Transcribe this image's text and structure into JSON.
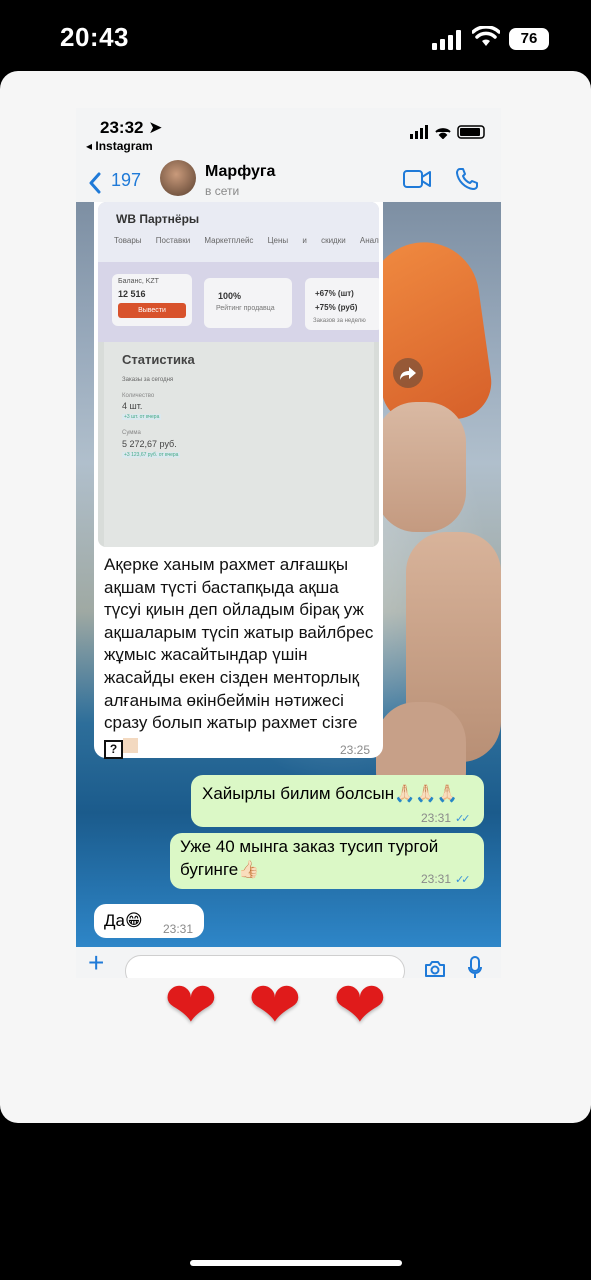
{
  "status_bar": {
    "time": "20:43",
    "battery": "76"
  },
  "inner_status": {
    "time": "23:32 ➤",
    "back_app": "◂ Instagram"
  },
  "chat_header": {
    "back_count": "197",
    "contact_name": "Марфуга",
    "contact_status": "в сети"
  },
  "screenshot": {
    "title": "WB Партнёры",
    "menu": "Товары Поставки Маркетплейс Цены и скидки Аналитика Ка",
    "balance_label": "Баланс, KZT",
    "balance_value": "12 516",
    "withdraw_button": "Вывести",
    "rating_value": "100%",
    "rating_label": "Рейтинг продавца",
    "orders_pieces": "+67% (шт)",
    "orders_rub": "+75% (руб)",
    "orders_label": "Заказов за неделю",
    "stats_title": "Статистика",
    "stats_today": "Заказы за сегодня",
    "qty_label": "Количество",
    "qty_value": "4 шт.",
    "qty_change": "+3 шт. от вчера",
    "sum_label": "Сумма",
    "sum_value": "5 272,67 руб.",
    "sum_change": "+3 123,67 руб. от вчера"
  },
  "messages": [
    {
      "text": "Ақерке ханым рахмет алғашқы ақшам түсті бастапқыда ақша түсуі қиын деп ойладым бірақ уж ақшаларым түсіп жатыр вайлбрес жұмыс жасайтындар үшін жасайды екен сізден менторлық алғаныма өкінбеймін нәтижесі сразу болып жатыр рахмет сізге",
      "time": "23:25"
    },
    {
      "text": "Хайырлы билим болсын🙏🏻🙏🏻🙏🏻",
      "time": "23:31"
    },
    {
      "text": "Уже 40 мынга заказ тусип тургой бугинге👍🏻",
      "time": "23:31"
    },
    {
      "text": "Да😁",
      "time": "23:31"
    }
  ],
  "hearts": [
    "❤",
    "❤",
    "❤"
  ],
  "colors": {
    "accent": "#1f7ad8",
    "outgoing_bubble": "#dbf8c6",
    "heart": "#e01b1b"
  }
}
